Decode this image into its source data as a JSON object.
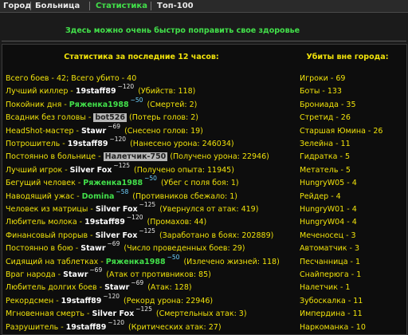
{
  "tabs": [
    {
      "label": "Город",
      "active": false
    },
    {
      "label": "Больница",
      "active": false
    },
    {
      "label": "Статистика",
      "active": true
    },
    {
      "label": "Топ-100",
      "active": false
    }
  ],
  "notice": "Здесь можно очень быстро поправить свое здоровье",
  "left_title": "Статистика за последние 12 часов:",
  "right_title": "Убиты вне города:",
  "stats": [
    {
      "label": "Всего боев - 42; Всего убито - 40"
    },
    {
      "label": "Лучший киллер",
      "name": "19staff89",
      "level": "120",
      "detail": "(Убийств: 118)"
    },
    {
      "label": "Покойник дня",
      "name": "Ряженка1988",
      "name_style": "green",
      "level": "50",
      "level_style": "cyan",
      "detail": "(Смертей: 2)"
    },
    {
      "label": "Всадник без головы",
      "name": "bot526",
      "name_style": "dark",
      "detail": "(Потерь голов: 2)"
    },
    {
      "label": "HeadShot-мастер",
      "name": "Stawr",
      "level": "69",
      "detail": "(Снесено голов: 19)"
    },
    {
      "label": "Потрошитель",
      "name": "19staff89",
      "level": "120",
      "detail": "(Нанесено урона: 246034)"
    },
    {
      "label": "Постоянно в больнице",
      "name": "Налетчик-750",
      "name_style": "dark",
      "detail": "(Получено урона: 22946)"
    },
    {
      "label": "Лучший игрок",
      "name": "Silver Fox",
      "level": "125",
      "detail": "(Получено опыта: 11945)"
    },
    {
      "label": "Бегущий человек",
      "name": "Ряженка1988",
      "name_style": "green",
      "level": "50",
      "level_style": "cyan",
      "detail": "(Убег с поля боя: 1)"
    },
    {
      "label": "Наводящий ужас",
      "name": "Domina",
      "name_style": "green",
      "level": "58",
      "level_style": "cyan",
      "detail": "(Противников сбежало: 1)"
    },
    {
      "label": "Человек из матрицы",
      "name": "Silver Fox",
      "level": "125",
      "detail": "(Увернулся от атак: 419)"
    },
    {
      "label": "Любитель молока",
      "name": "19staff89",
      "level": "120",
      "detail": "(Промахов: 44)"
    },
    {
      "label": "Финансовый прорыв",
      "name": "Silver Fox",
      "level": "125",
      "detail": "(Заработано в боях: 202889)"
    },
    {
      "label": "Постоянно в бою",
      "name": "Stawr",
      "level": "69",
      "detail": "(Число проведенных боев: 29)"
    },
    {
      "label": "Сидящий на таблетках",
      "name": "Ряженка1988",
      "name_style": "green",
      "level": "50",
      "level_style": "cyan",
      "detail": "(Излечено жизней: 118)"
    },
    {
      "label": "Враг народа",
      "name": "Stawr",
      "level": "69",
      "detail": "(Атак от противников: 85)"
    },
    {
      "label": "Любитель долгих боев",
      "name": "Stawr",
      "level": "69",
      "detail": "(Атак: 128)"
    },
    {
      "label": "Рекордсмен",
      "name": "19staff89",
      "level": "120",
      "detail": "(Рекорд урона: 22946)"
    },
    {
      "label": "Мгновенная смерть",
      "name": "Silver Fox",
      "level": "125",
      "detail": "(Смертельных атак: 3)"
    },
    {
      "label": "Разрушитель",
      "name": "19staff89",
      "level": "120",
      "detail": "(Критических атак: 27)"
    }
  ],
  "killed": [
    "Игроки - 69",
    "Боты - 133",
    "Брониада - 35",
    "Стретид - 26",
    "Старшая Юмина - 26",
    "Зелейна - 11",
    "Гидратка - 5",
    "Метатель - 5",
    "HungryW05 - 4",
    "Рейдер - 4",
    "HungryW01 - 4",
    "HungryW04 - 4",
    "Меченосец - 3",
    "Автоматчик - 3",
    "Песчанница - 1",
    "Снайперюга - 1",
    "Налетчик - 1",
    "Зубоскалка - 11",
    "Импердина - 11",
    "Наркоманка - 10"
  ]
}
